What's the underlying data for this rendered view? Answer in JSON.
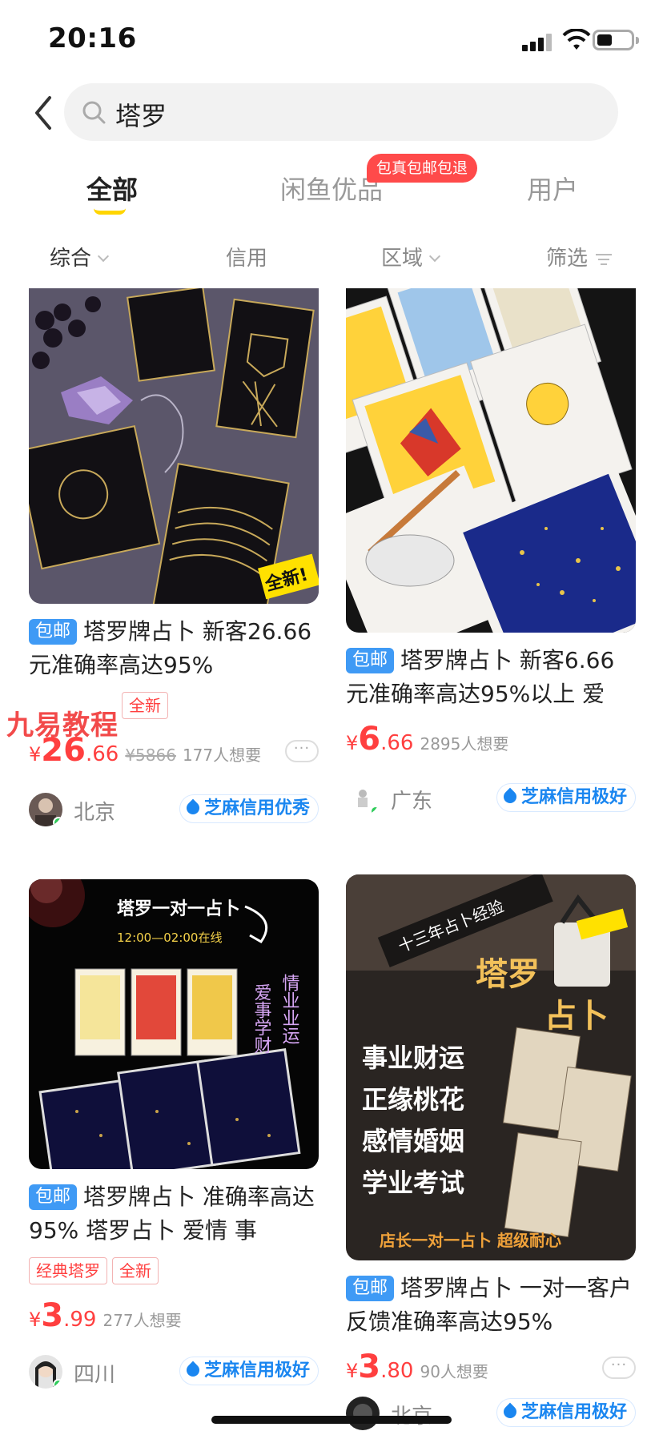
{
  "status_bar": {
    "time": "20:16"
  },
  "search": {
    "query": "塔罗"
  },
  "tabs": [
    {
      "label": "全部"
    },
    {
      "label": "闲鱼优品",
      "promo": "包真包邮包退"
    },
    {
      "label": "用户"
    }
  ],
  "filters": [
    {
      "label": "综合"
    },
    {
      "label": "信用"
    },
    {
      "label": "区域"
    },
    {
      "label": "筛选"
    }
  ],
  "watermark": "九易教程",
  "products": [
    {
      "shipping_badge": "包邮",
      "title": "塔罗牌占卜 新客26.66元准确率高达95%",
      "tags": [
        "全新"
      ],
      "currency": "¥",
      "price_int": "26",
      "price_dec": ".66",
      "original_price": "¥5866",
      "wants": "177人想要",
      "region": "北京",
      "credit": "芝麻信用优秀"
    },
    {
      "shipping_badge": "包邮",
      "title": "塔罗牌占卜 新客6.66元准确率高达95%以上 爱",
      "tags": [],
      "currency": "¥",
      "price_int": "6",
      "price_dec": ".66",
      "wants": "2895人想要",
      "region": "广东",
      "credit": "芝麻信用极好"
    },
    {
      "shipping_badge": "包邮",
      "title": "塔罗牌占卜 准确率高达95% 塔罗占卜 爱情 事",
      "tags": [
        "经典塔罗",
        "全新"
      ],
      "currency": "¥",
      "price_int": "3",
      "price_dec": ".99",
      "wants": "277人想要",
      "region": "四川",
      "credit": "芝麻信用极好",
      "image_text": {
        "heading": "塔罗一对一占卜",
        "hours": "12:00—02:00在线",
        "right_col_1": "爱事学财",
        "right_col_2": "情业业运"
      }
    },
    {
      "shipping_badge": "包邮",
      "title": "塔罗牌占卜 一对一客户反馈准确率高达95%",
      "tags": [],
      "currency": "¥",
      "price_int": "3",
      "price_dec": ".80",
      "wants": "90人想要",
      "region": "北京",
      "credit": "芝麻信用极好",
      "image_text": {
        "banner": "十三年占卜经验",
        "title_1": "塔罗",
        "title_2": "占卜",
        "lines": [
          "事业财运",
          "正缘桃花",
          "感情婚姻",
          "学业考试"
        ],
        "footer": "店长一对一占卜 超级耐心"
      }
    }
  ]
}
